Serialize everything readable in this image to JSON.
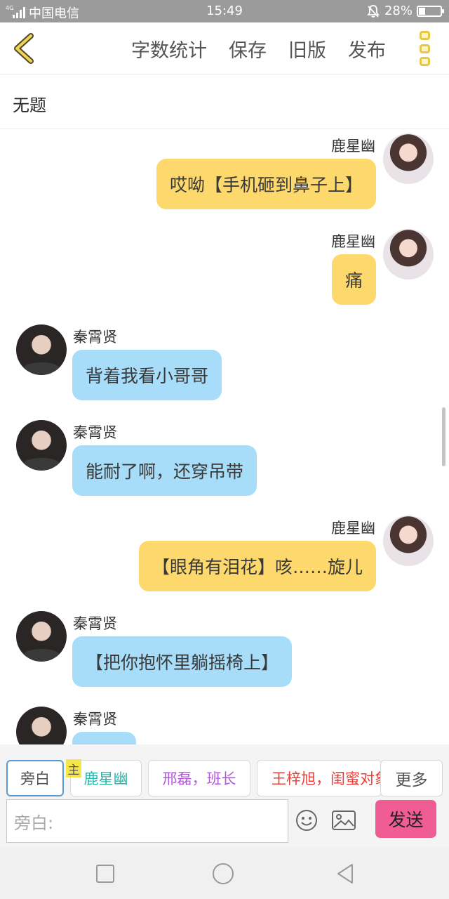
{
  "status_bar": {
    "network": "4G",
    "carrier": "中国电信",
    "time": "15:49",
    "battery": "28%",
    "battery_level": 0.28
  },
  "toolbar": {
    "word_count_label": "字数统计",
    "save_label": "保存",
    "old_version_label": "旧版",
    "publish_label": "发布"
  },
  "document": {
    "title": "无题"
  },
  "messages": [
    {
      "side": "right",
      "speaker": "鹿星幽",
      "text": "哎呦【手机砸到鼻子上】"
    },
    {
      "side": "right",
      "speaker": "鹿星幽",
      "text": "痛"
    },
    {
      "side": "left",
      "speaker": "秦霄贤",
      "text": "背着我看小哥哥"
    },
    {
      "side": "left",
      "speaker": "秦霄贤",
      "text": "能耐了啊，还穿吊带"
    },
    {
      "side": "right",
      "speaker": "鹿星幽",
      "text": "【眼角有泪花】咳……旋儿"
    },
    {
      "side": "left",
      "speaker": "秦霄贤",
      "text": "【把你抱怀里躺摇椅上】"
    },
    {
      "side": "left",
      "speaker": "秦霄贤",
      "text": ""
    }
  ],
  "characters": {
    "narration": "旁白",
    "main_badge": "主",
    "items": [
      {
        "label": "鹿星幽",
        "color": "#2cb3a8"
      },
      {
        "label": "邢磊，班长",
        "color": "#b05bd6"
      },
      {
        "label": "王梓旭，闺蜜对象",
        "color": "#e8413c"
      }
    ],
    "more_label": "更多"
  },
  "input": {
    "placeholder": "旁白:",
    "send_label": "发送"
  },
  "colors": {
    "self_bubble": "#fdd96d",
    "other_bubble": "#a8ddf9",
    "send_button": "#f05d94",
    "accent": "#e8c84a"
  },
  "icons": {
    "back": "chevron-left-icon",
    "more": "vertical-dots-icon",
    "emoji": "smiley-icon",
    "image": "image-icon",
    "nav_recent": "square-icon",
    "nav_home": "circle-icon",
    "nav_back": "triangle-back-icon"
  }
}
